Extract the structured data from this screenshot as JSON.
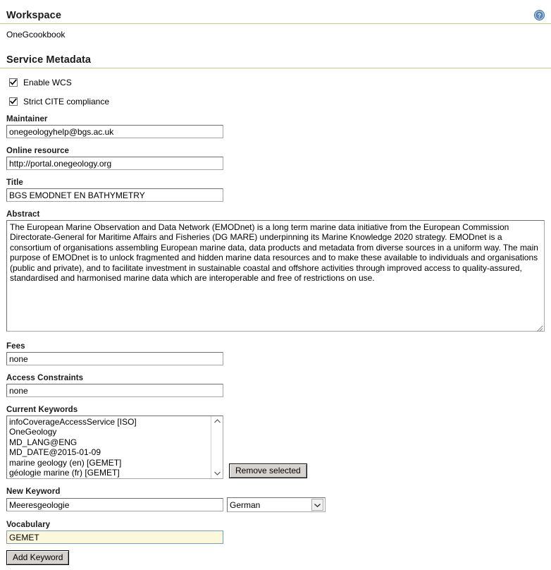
{
  "header": {
    "title": "Workspace",
    "help_icon": "help-circle-icon",
    "workspace_name": "OneGcookbook"
  },
  "service_metadata": {
    "title": "Service Metadata",
    "checkboxes": [
      {
        "label": "Enable WCS",
        "checked": true
      },
      {
        "label": "Strict CITE compliance",
        "checked": true
      }
    ],
    "fields": {
      "maintainer": {
        "label": "Maintainer",
        "value": "onegeologyhelp@bgs.ac.uk"
      },
      "online_resource": {
        "label": "Online resource",
        "value": "http://portal.onegeology.org"
      },
      "title_field": {
        "label": "Title",
        "value": "BGS EMODNET EN BATHYMETRY"
      },
      "abstract": {
        "label": "Abstract",
        "value": "The European Marine Observation and Data Network (EMODnet) is a long term marine data initiative from the European Commission Directorate-General for Maritime Affairs and Fisheries (DG MARE) underpinning its Marine Knowledge 2020 strategy. EMODnet is a consortium of organisations assembling European marine data, data products and metadata from diverse sources in a uniform way. The main purpose of EMODnet is to unlock fragmented and hidden marine data resources and to make these available to individuals and organisations (public and private), and to facilitate investment in sustainable coastal and offshore activities through improved access to quality-assured, standardised and harmonised marine data which are interoperable and free of restrictions on use."
      },
      "fees": {
        "label": "Fees",
        "value": "none"
      },
      "access_constraints": {
        "label": "Access Constraints",
        "value": "none"
      }
    },
    "keywords": {
      "label": "Current Keywords",
      "items": [
        "infoCoverageAccessService [ISO]",
        "OneGeology",
        "MD_LANG@ENG",
        "MD_DATE@2015-01-09",
        "marine geology (en) [GEMET]",
        "géologie marine (fr) [GEMET]"
      ],
      "remove_button": "Remove selected",
      "scroll_up_icon": "chevron-up-icon",
      "scroll_down_icon": "chevron-down-icon"
    },
    "new_keyword": {
      "label": "New Keyword",
      "value": "Meeresgeologie",
      "language": "German",
      "language_caret_icon": "chevron-down-icon"
    },
    "vocabulary": {
      "label": "Vocabulary",
      "value": "GEMET",
      "focused": true
    },
    "add_button": "Add Keyword"
  },
  "colors": {
    "rule": "#c8cb8f",
    "focus_background": "#fdf8dc",
    "focus_border": "#7a9cb8",
    "button_face": "#d6d3ce"
  }
}
